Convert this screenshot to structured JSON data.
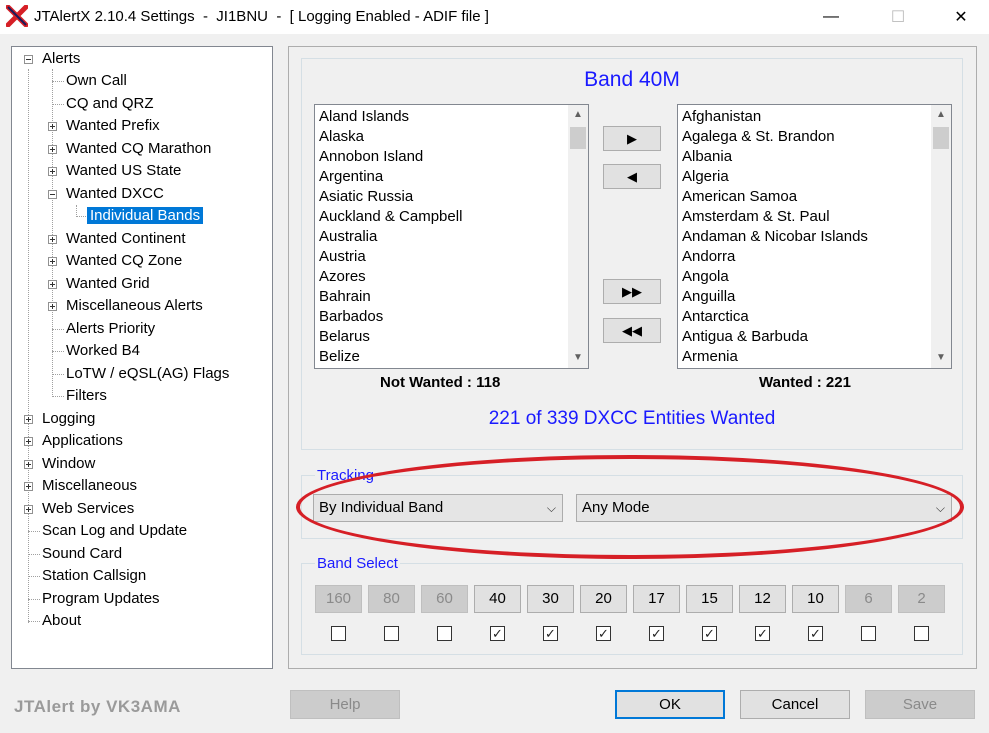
{
  "window": {
    "title": "JTAlertX 2.10.4 Settings  -  JI1BNU  -  [ Logging Enabled - ADIF file ]",
    "minimize_icon": "minimize-icon",
    "maximize_icon": "maximize-icon",
    "close_icon": "close-icon",
    "accent": "#0078d7"
  },
  "tree": {
    "alerts": "Alerts",
    "own_call": "Own Call",
    "cq_qrz": "CQ and QRZ",
    "wanted_prefix": "Wanted Prefix",
    "wanted_cq_marathon": "Wanted CQ Marathon",
    "wanted_us_state": "Wanted US State",
    "wanted_dxcc": "Wanted DXCC",
    "individual_bands": "Individual Bands",
    "wanted_continent": "Wanted Continent",
    "wanted_cq_zone": "Wanted CQ Zone",
    "wanted_grid": "Wanted Grid",
    "misc_alerts": "Miscellaneous Alerts",
    "alerts_priority": "Alerts Priority",
    "worked_b4": "Worked B4",
    "lotw": "LoTW / eQSL(AG) Flags",
    "filters": "Filters",
    "logging": "Logging",
    "applications": "Applications",
    "window": "Window",
    "miscellaneous": "Miscellaneous",
    "web_services": "Web Services",
    "scan_log": "Scan Log and Update",
    "sound_card": "Sound Card",
    "station_callsign": "Station Callsign",
    "program_updates": "Program Updates",
    "about": "About"
  },
  "band_panel": {
    "title": "Band 40M",
    "not_wanted": [
      "Aland Islands",
      "Alaska",
      "Annobon Island",
      "Argentina",
      "Asiatic Russia",
      "Auckland & Campbell",
      "Australia",
      "Austria",
      "Azores",
      "Bahrain",
      "Barbados",
      "Belarus",
      "Belize"
    ],
    "wanted": [
      "Afghanistan",
      "Agalega & St. Brandon",
      "Albania",
      "Algeria",
      "American Samoa",
      "Amsterdam & St. Paul",
      "Andaman & Nicobar Islands",
      "Andorra",
      "Angola",
      "Anguilla",
      "Antarctica",
      "Antigua & Barbuda",
      "Armenia"
    ],
    "not_wanted_label": "Not Wanted : 118",
    "wanted_label": "Wanted : 221",
    "summary": "221 of 339 DXCC Entities Wanted",
    "buttons": {
      "move_right": "▶",
      "move_left": "◀",
      "move_all_right": "▶▶",
      "move_all_left": "◀◀"
    }
  },
  "tracking": {
    "label": "Tracking",
    "band_mode": "By Individual Band",
    "mode": "Any Mode"
  },
  "band_select": {
    "label": "Band Select",
    "bands": [
      {
        "label": "160",
        "enabled": false,
        "checked": false
      },
      {
        "label": "80",
        "enabled": false,
        "checked": false
      },
      {
        "label": "60",
        "enabled": false,
        "checked": false
      },
      {
        "label": "40",
        "enabled": true,
        "checked": true
      },
      {
        "label": "30",
        "enabled": true,
        "checked": true
      },
      {
        "label": "20",
        "enabled": true,
        "checked": true
      },
      {
        "label": "17",
        "enabled": true,
        "checked": true
      },
      {
        "label": "15",
        "enabled": true,
        "checked": true
      },
      {
        "label": "12",
        "enabled": true,
        "checked": true
      },
      {
        "label": "10",
        "enabled": true,
        "checked": true
      },
      {
        "label": "6",
        "enabled": false,
        "checked": false
      },
      {
        "label": "2",
        "enabled": false,
        "checked": false
      }
    ]
  },
  "footer": {
    "credit": "JTAlert by VK3AMA",
    "help": "Help",
    "ok": "OK",
    "cancel": "Cancel",
    "save": "Save"
  }
}
